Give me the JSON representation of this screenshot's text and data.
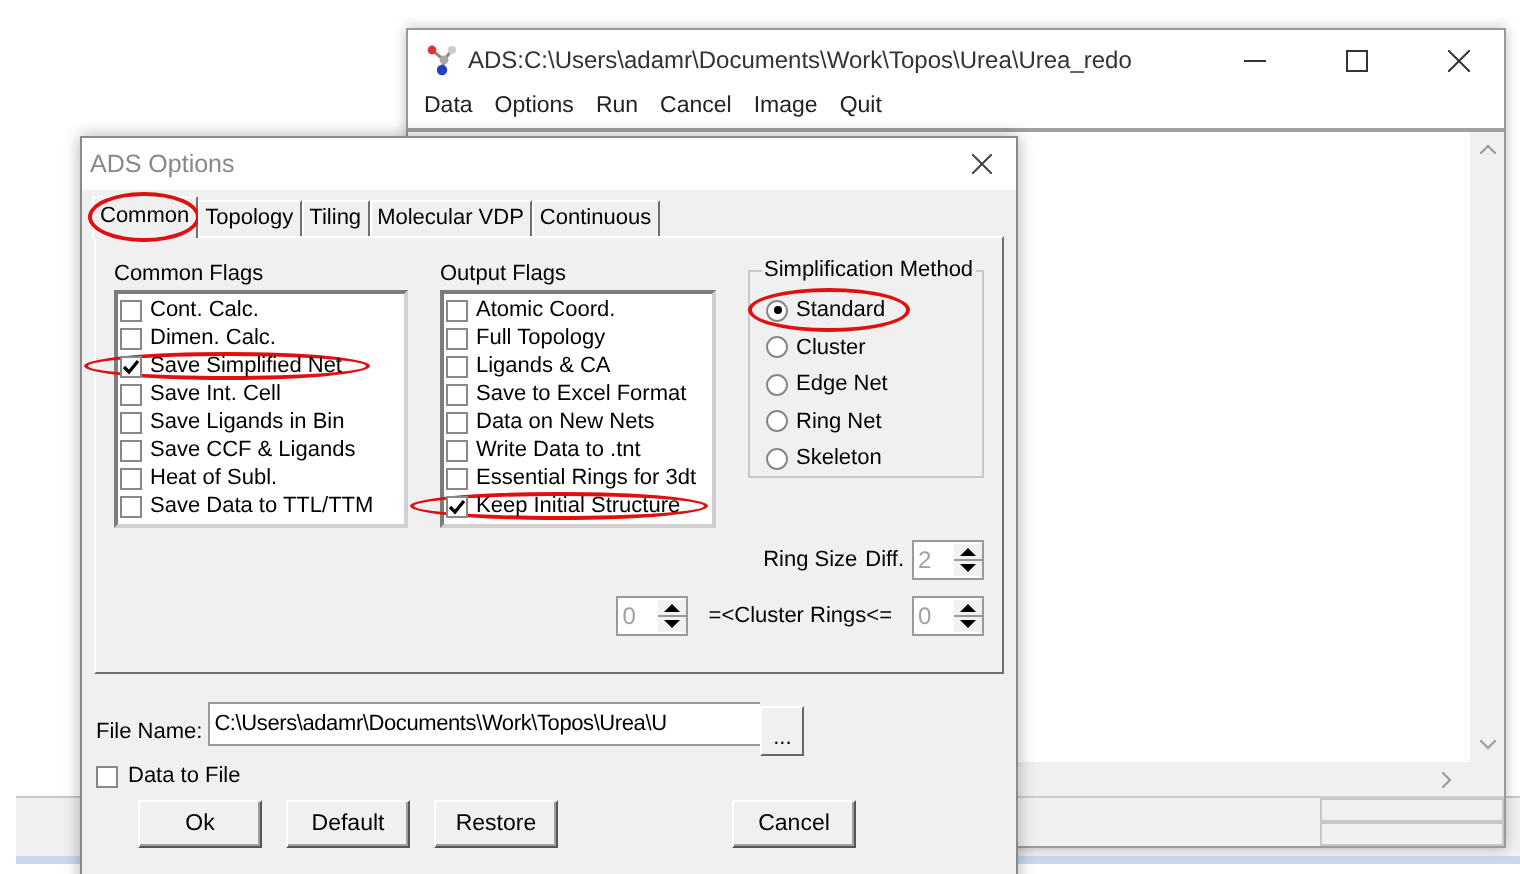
{
  "main_window": {
    "title": "ADS:C:\\Users\\adamr\\Documents\\Work\\Topos\\Urea\\Urea_redo",
    "menu": [
      "Data",
      "Options",
      "Run",
      "Cancel",
      "Image",
      "Quit"
    ]
  },
  "dialog": {
    "title": "ADS Options",
    "tabs": [
      {
        "label": "Common",
        "selected": true,
        "circled": true
      },
      {
        "label": "Topology",
        "selected": false,
        "circled": false
      },
      {
        "label": "Tiling",
        "selected": false,
        "circled": false
      },
      {
        "label": "Molecular VDP",
        "selected": false,
        "circled": false
      },
      {
        "label": "Continuous",
        "selected": false,
        "circled": false
      }
    ],
    "common_flags": {
      "label": "Common Flags",
      "items": [
        {
          "label": "Cont. Calc.",
          "checked": false,
          "circled": false
        },
        {
          "label": "Dimen. Calc.",
          "checked": false,
          "circled": false
        },
        {
          "label": "Save Simplified Net",
          "checked": true,
          "circled": true
        },
        {
          "label": "Save Int. Cell",
          "checked": false,
          "circled": false
        },
        {
          "label": "Save Ligands in Bin",
          "checked": false,
          "circled": false
        },
        {
          "label": "Save CCF & Ligands",
          "checked": false,
          "circled": false
        },
        {
          "label": "Heat of Subl.",
          "checked": false,
          "circled": false
        },
        {
          "label": "Save Data to TTL/TTM",
          "checked": false,
          "circled": false
        }
      ]
    },
    "output_flags": {
      "label": "Output Flags",
      "items": [
        {
          "label": "Atomic Coord.",
          "checked": false,
          "circled": false
        },
        {
          "label": "Full Topology",
          "checked": false,
          "circled": false
        },
        {
          "label": "Ligands & CA",
          "checked": false,
          "circled": false
        },
        {
          "label": "Save to Excel Format",
          "checked": false,
          "circled": false
        },
        {
          "label": "Data on New Nets",
          "checked": false,
          "circled": false
        },
        {
          "label": "Write Data to .tnt",
          "checked": false,
          "circled": false
        },
        {
          "label": "Essential Rings for 3dt",
          "checked": false,
          "circled": false
        },
        {
          "label": "Keep Initial Structure",
          "checked": true,
          "circled": true
        }
      ]
    },
    "simplification_method": {
      "label": "Simplification Method",
      "options": [
        {
          "label": "Standard",
          "selected": true,
          "circled": true
        },
        {
          "label": "Cluster",
          "selected": false,
          "circled": false
        },
        {
          "label": "Edge Net",
          "selected": false,
          "circled": false
        },
        {
          "label": "Ring Net",
          "selected": false,
          "circled": false
        },
        {
          "label": "Skeleton",
          "selected": false,
          "circled": false
        }
      ]
    },
    "ring_size": {
      "label": "Ring Size",
      "diff_label": "Diff.",
      "value": "2"
    },
    "cluster_rings": {
      "min": "0",
      "label": "=<Cluster Rings<=",
      "max": "0"
    },
    "file_name": {
      "label": "File Name:",
      "value": "C:\\Users\\adamr\\Documents\\Work\\Topos\\Urea\\U",
      "browse": "..."
    },
    "data_to_file": {
      "label": "Data to File",
      "checked": false
    },
    "buttons": [
      "Ok",
      "Default",
      "Restore",
      "Cancel"
    ]
  }
}
